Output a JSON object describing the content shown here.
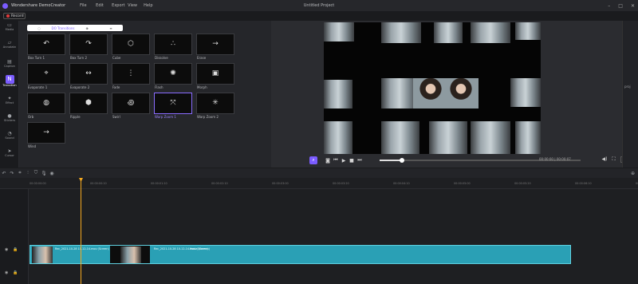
{
  "app": {
    "name": "Wondershare DemoCreator",
    "project_title": "Untitled Project"
  },
  "menu": [
    "File",
    "Edit",
    "Export",
    "View",
    "Help"
  ],
  "record_button": "Record",
  "sidebar": [
    {
      "label": "Media",
      "icon": "folder-icon"
    },
    {
      "label": "Annotatn",
      "icon": "annotation-icon"
    },
    {
      "label": "Caption",
      "icon": "caption-icon"
    },
    {
      "label": "Transition",
      "icon": "transition-icon",
      "active": true
    },
    {
      "label": "Effect",
      "icon": "effect-icon"
    },
    {
      "label": "Stickers",
      "icon": "sticker-icon"
    },
    {
      "label": "Sound",
      "icon": "sound-icon"
    },
    {
      "label": "Cursor",
      "icon": "cursor-icon"
    }
  ],
  "library_tabs": [
    "◌",
    "DO Transitions",
    "⊕",
    "≡"
  ],
  "transitions": [
    {
      "label": "Box Turn 1"
    },
    {
      "label": "Box Turn 2"
    },
    {
      "label": "Cube"
    },
    {
      "label": "Dissolve"
    },
    {
      "label": "Erase"
    },
    {
      "label": "Evaporate 1"
    },
    {
      "label": "Evaporate 2"
    },
    {
      "label": "Fade"
    },
    {
      "label": "Flash"
    },
    {
      "label": "Morph"
    },
    {
      "label": "Orb"
    },
    {
      "label": "Ripple"
    },
    {
      "label": "Swirl"
    },
    {
      "label": "Warp Zoom 1",
      "selected": true
    },
    {
      "label": "Warp Zoom 2"
    },
    {
      "label": "Wind"
    }
  ],
  "player": {
    "timecode": "00:00:00 | 00:00:07",
    "fit": "Fit",
    "progress": 0.11
  },
  "right_panel_text": "proj",
  "toolbar_icons": [
    "undo-icon",
    "redo-icon",
    "crop-icon",
    "split-icon",
    "marker-icon",
    "mic-icon",
    "camera-icon"
  ],
  "ruler_ticks": [
    "00:00:00:00",
    "00:00:00:10",
    "00:00:01:10",
    "00:00:02:10",
    "00:00:03:00",
    "00:00:03:20",
    "00:00:04:10",
    "00:00:05:00",
    "00:00:05:20",
    "00:00:06:10",
    "00:00:07:00"
  ],
  "clips": [
    {
      "label": "Rec_2021-10-28 10-12-14.mov (Screen)"
    },
    {
      "label": "Rec_2021-10-28 10-12-14.mov (Screen)"
    },
    {
      "label": "Nokia (Screen)"
    }
  ],
  "colors": {
    "accent": "#7b5cff",
    "clip": "#2aa0b5",
    "playhead": "#f4a820"
  }
}
